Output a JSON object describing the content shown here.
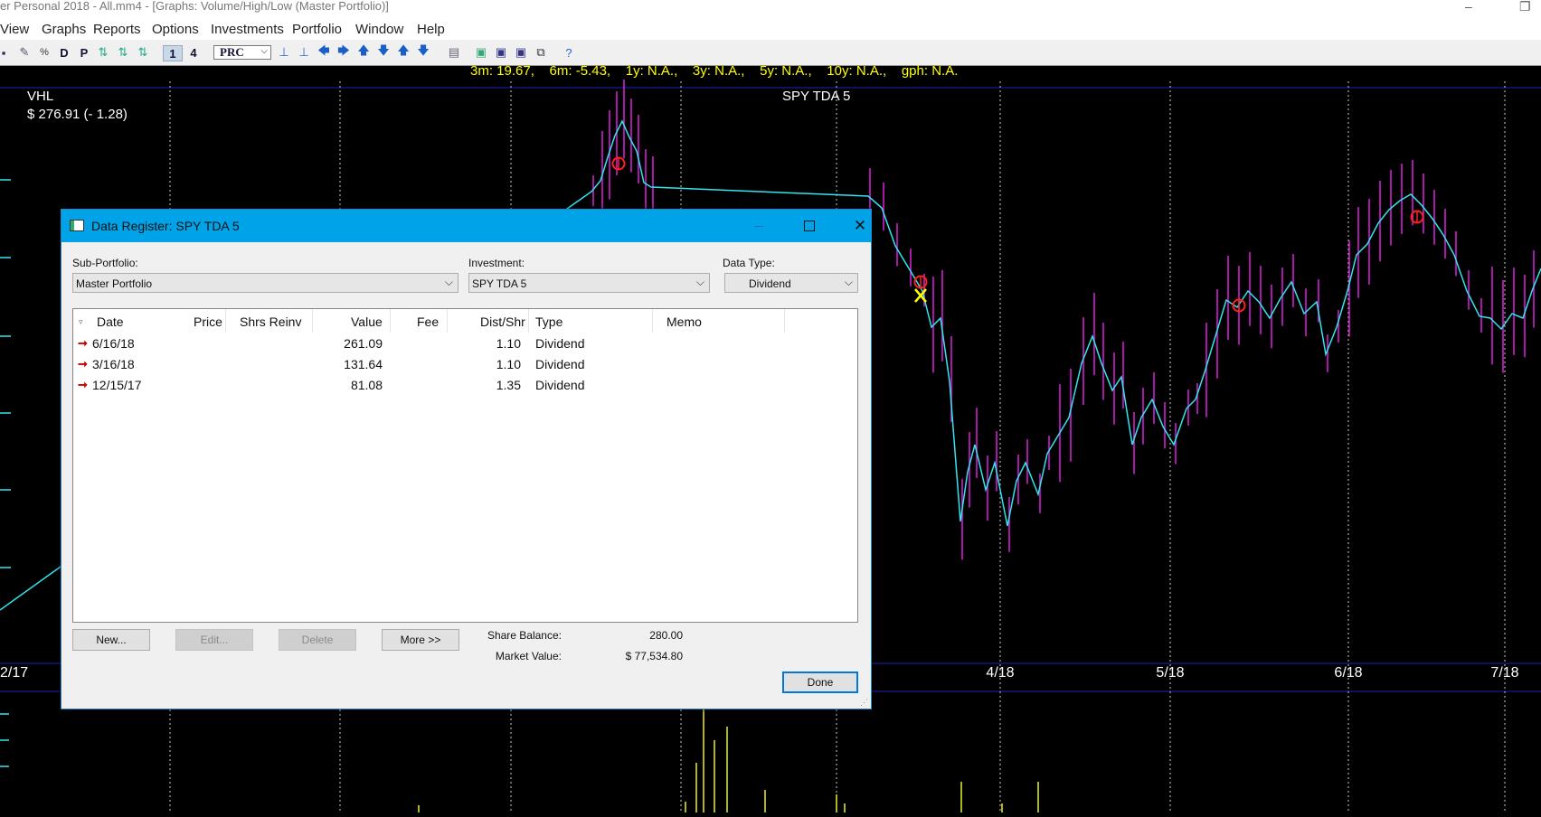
{
  "app_title": "er Personal 2018 - All.mm4 - [Graphs: Volume/High/Low (Master Portfolio)]",
  "menu": [
    "View",
    "Graphs",
    "Reports",
    "Options",
    "Investments",
    "Portfolio",
    "Window",
    "Help"
  ],
  "toolbar": {
    "d_label": "D",
    "p_label": "P",
    "one_label": "1",
    "four_label": "4",
    "prc_combo": "PRC"
  },
  "chart": {
    "returns_line": "3m: 19.67,    6m: -5.43,    1y: N.A.,    3y: N.A.,    5y: N.A.,    10y: N.A.,    gph: N.A.",
    "ticker": "VHL",
    "price_line": "$ 276.91 (- 1.28)",
    "title": "SPY TDA 5",
    "x_labels": [
      "2/17",
      "4/18",
      "5/18",
      "6/18",
      "7/18"
    ],
    "colors": {
      "background": "#000000",
      "price_line": "#33e5f0",
      "high_low_bars": "#e020e0",
      "volume_bars": "#f0f020",
      "grid": "#ffffff",
      "axis_lines": "#2020c0",
      "header_text": "#ffff00",
      "dividend_marker": "#ff2020",
      "current_marker": "#ffff00"
    }
  },
  "dialog": {
    "title": "Data Register: SPY TDA 5",
    "sub_portfolio_label": "Sub-Portfolio:",
    "sub_portfolio_value": "Master Portfolio",
    "investment_label": "Investment:",
    "investment_value": "SPY TDA 5",
    "data_type_label": "Data Type:",
    "data_type_value": "Dividend",
    "columns": [
      "Date",
      "Price",
      "Shrs Reinv",
      "Value",
      "Fee",
      "Dist/Shr",
      "Type",
      "Memo"
    ],
    "rows": [
      {
        "date": "6/16/18",
        "price": "",
        "shrs": "",
        "value": "261.09",
        "fee": "",
        "dist": "1.10",
        "type": "Dividend",
        "memo": ""
      },
      {
        "date": "3/16/18",
        "price": "",
        "shrs": "",
        "value": "131.64",
        "fee": "",
        "dist": "1.10",
        "type": "Dividend",
        "memo": ""
      },
      {
        "date": "12/15/17",
        "price": "",
        "shrs": "",
        "value": "81.08",
        "fee": "",
        "dist": "1.35",
        "type": "Dividend",
        "memo": ""
      }
    ],
    "buttons": {
      "new": "New...",
      "edit": "Edit...",
      "delete": "Delete",
      "more": "More >>",
      "done": "Done"
    },
    "share_balance_label": "Share Balance:",
    "share_balance_value": "280.00",
    "market_value_label": "Market Value:",
    "market_value_value": "$ 77,534.80"
  }
}
